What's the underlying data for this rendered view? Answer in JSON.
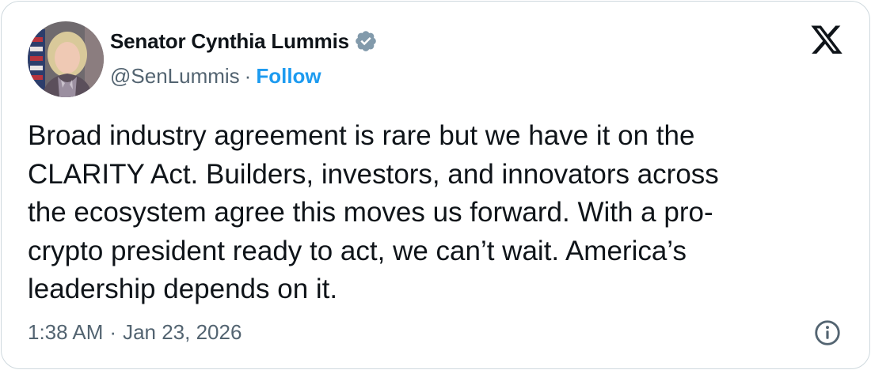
{
  "author": {
    "display_name": "Senator Cynthia Lummis",
    "handle": "@SenLummis",
    "separator": "·",
    "follow_label": "Follow",
    "verified_badge_color": "#829aab"
  },
  "tweet": {
    "text": "Broad industry agreement is rare but we have it on the\nCLARITY Act. Builders, investors, and innovators across\nthe ecosystem agree this moves us forward. With a pro-\ncrypto president ready to act, we can’t wait. America’s\nleadership depends on it.",
    "time": "1:38 AM",
    "date_separator": "·",
    "date": "Jan 23, 2026"
  },
  "icons": {
    "brand": "x-logo-icon",
    "verified": "verified-badge-icon",
    "info": "info-icon"
  },
  "colors": {
    "text_primary": "#0f1419",
    "text_secondary": "#536471",
    "accent": "#1d9bf0",
    "border": "#cfd9de"
  }
}
